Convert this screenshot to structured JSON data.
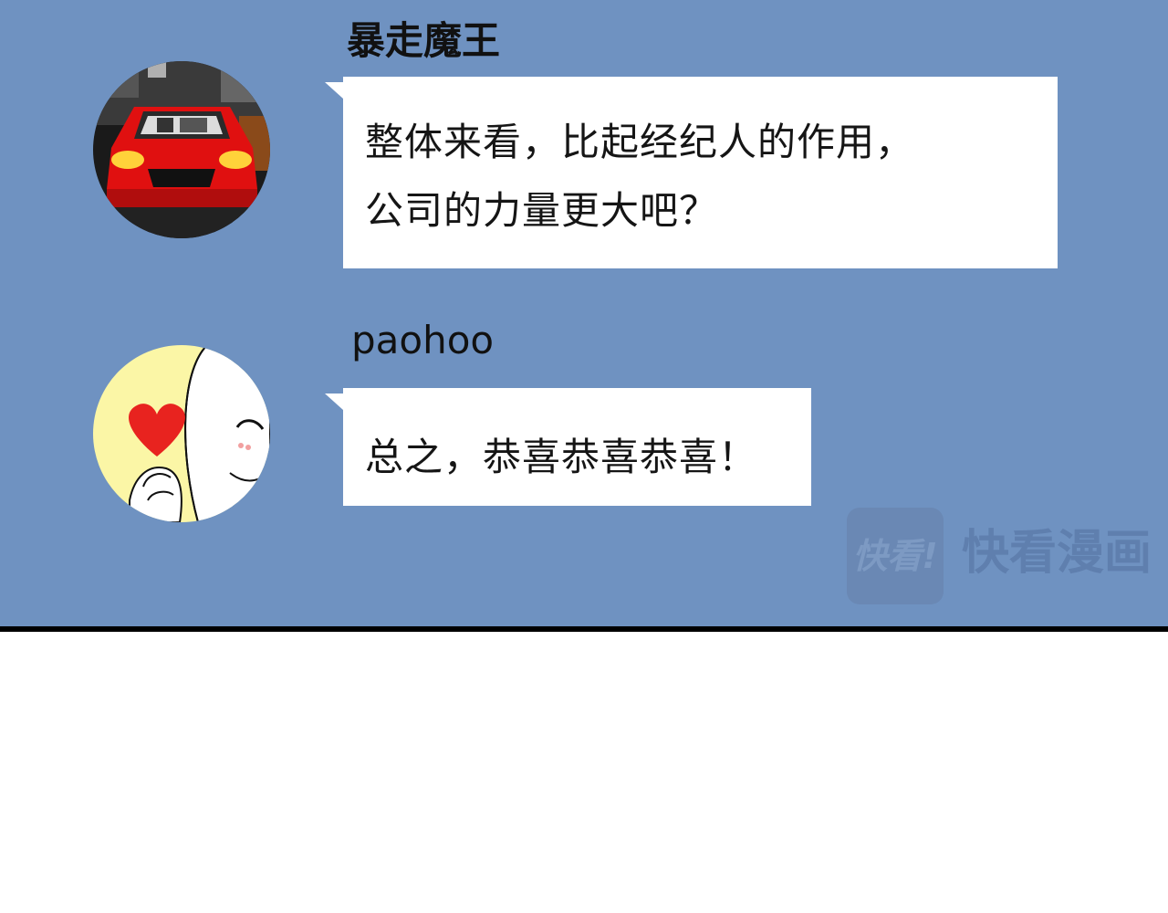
{
  "messages": [
    {
      "sender": "暴走魔王",
      "avatar": "red-sports-car-avatar",
      "lines": [
        "整体来看，比起经纪人的作用，",
        "公司的力量更大吧？"
      ]
    },
    {
      "sender": "paohoo",
      "avatar": "heart-smiley-avatar",
      "lines": [
        "总之，恭喜恭喜恭喜！"
      ]
    }
  ],
  "watermark": {
    "badge": "快看!",
    "text": "快看漫画"
  },
  "colors": {
    "panel_background": "#6f92c1",
    "bubble_background": "#ffffff",
    "divider": "#000000"
  }
}
